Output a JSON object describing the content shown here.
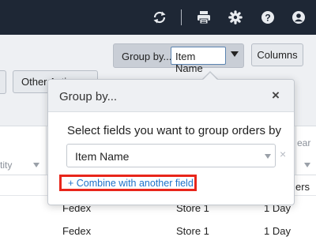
{
  "topbar": {
    "icons": [
      "refresh-icon",
      "printer-icon",
      "gear-icon",
      "help-icon",
      "user-icon"
    ]
  },
  "toolbar": {
    "group_by_label": "Group by...",
    "group_by_value": "Item Name",
    "columns_label": "Columns",
    "other_actions_label": "Other Actions"
  },
  "table": {
    "headers": {
      "quantity": "tity",
      "ear": "ear"
    },
    "partial_row": {
      "ers": "ers"
    },
    "rows": [
      {
        "carrier": "Fedex",
        "store": "Store 1",
        "speed": "1 Day"
      },
      {
        "carrier": "Fedex",
        "store": "Store 1",
        "speed": "1 Day"
      }
    ]
  },
  "popover": {
    "title": "Group by...",
    "close_label": "×",
    "instruction": "Select fields you want to group orders by",
    "field_value": "Item Name",
    "remove_label": "×",
    "combine_label": "+ Combine with another field"
  }
}
